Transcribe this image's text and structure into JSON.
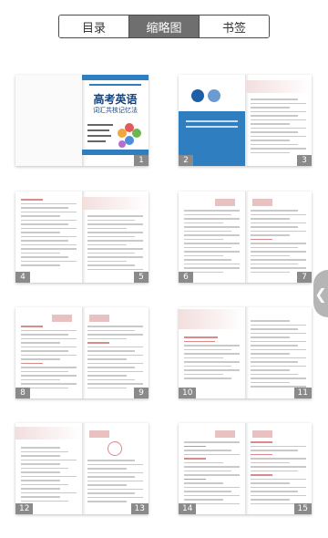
{
  "tabs": [
    {
      "label": "目录"
    },
    {
      "label": "缩略图"
    },
    {
      "label": "书签"
    }
  ],
  "active_tab": "缩略图",
  "cover": {
    "title": "高考英语",
    "subtitle": "词汇共核记忆法"
  },
  "page_numbers": [
    "1",
    "2",
    "3",
    "4",
    "5",
    "6",
    "7",
    "8",
    "9",
    "10",
    "11",
    "12",
    "13",
    "14",
    "15"
  ],
  "icons": {
    "side_handle": "chevron-left-icon"
  },
  "colors": {
    "accent_blue": "#15437f",
    "cover_blue": "#2f7fc0",
    "label_gray": "#8a8a8a"
  }
}
